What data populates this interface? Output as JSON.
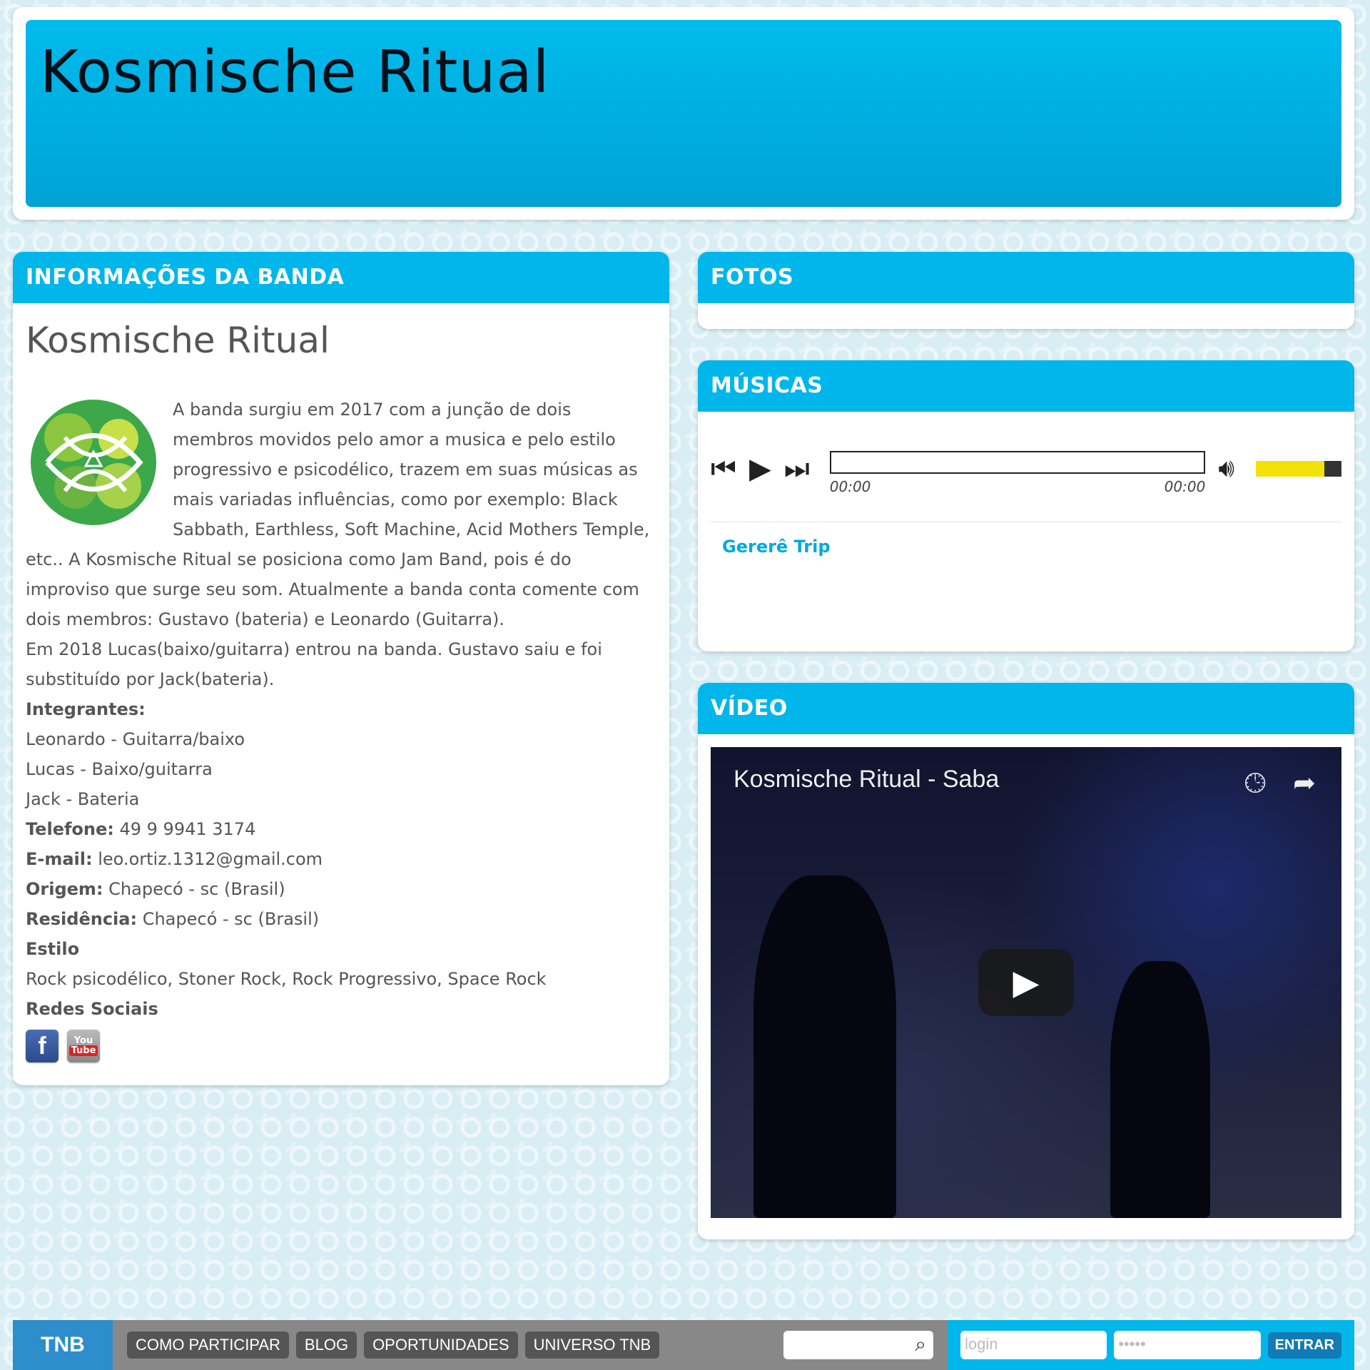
{
  "header": {
    "title": "Kosmische Ritual"
  },
  "info": {
    "heading": "INFORMAÇÕES DA BANDA",
    "band_name": "Kosmische Ritual",
    "bio_1": "A banda surgiu em 2017 com a junção de dois membros movidos pelo amor a musica e pelo estilo progressivo e psicodélico, trazem em suas músicas as mais variadas influências, como por exemplo: Black Sabbath, Earthless, Soft Machine, Acid Mothers Temple, etc.. A Kosmische Ritual se posiciona como Jam Band, pois é do improviso que surge seu som. Atualmente a banda conta comente com dois membros: Gustavo (bateria) e Leonardo (Guitarra).",
    "bio_2": "Em 2018 Lucas(baixo/guitarra) entrou na banda. Gustavo saiu e foi substituído por Jack(bateria).",
    "members_label": "Integrantes:",
    "members": [
      "Leonardo - Guitarra/baixo",
      "Lucas - Baixo/guitarra",
      "Jack - Bateria"
    ],
    "phone_label": "Telefone:",
    "phone": " 49 9 9941 3174",
    "email_label": "E-mail:",
    "email": " leo.ortiz.1312@gmail.com",
    "origin_label": "Origem:",
    "origin": " Chapecó - sc (Brasil)",
    "residence_label": "Residência:",
    "residence": " Chapecó - sc (Brasil)",
    "style_label": "Estilo",
    "style": "Rock psicodélico, Stoner Rock, Rock Progressivo, Space Rock",
    "social_label": "Redes Sociais",
    "social": {
      "facebook": "f",
      "youtube_top": "You",
      "youtube_bottom": "Tube"
    }
  },
  "fotos": {
    "heading": "FOTOS"
  },
  "musicas": {
    "heading": "MÚSICAS",
    "time_current": "00:00",
    "time_total": "00:00",
    "track": "Gererê Trip"
  },
  "video": {
    "heading": "VÍDEO",
    "title": "Kosmische Ritual - Saba"
  },
  "footer": {
    "logo": "TNB",
    "nav": [
      "COMO PARTICIPAR",
      "BLOG",
      "OPORTUNIDADES",
      "UNIVERSO TNB"
    ],
    "login_placeholder": "login",
    "password_mask": "•••••",
    "enter_label": "ENTRAR"
  },
  "colors": {
    "accent": "#00b6ea",
    "link": "#00a8dd",
    "volume": "#f2e208"
  }
}
